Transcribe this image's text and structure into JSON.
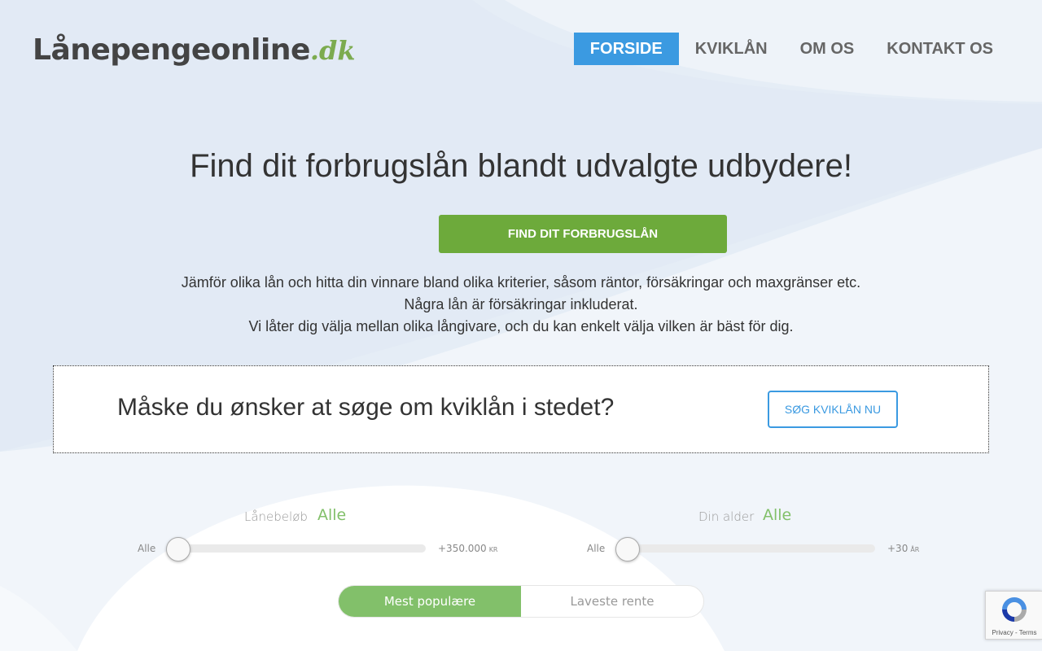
{
  "brand": {
    "name_main": "Lånepengeonline",
    "name_tld": ".dk"
  },
  "nav": [
    {
      "label": "FORSIDE",
      "active": true
    },
    {
      "label": "KVIKLÅN",
      "active": false
    },
    {
      "label": "OM OS",
      "active": false
    },
    {
      "label": "KONTAKT OS",
      "active": false
    }
  ],
  "hero": {
    "title": "Find dit forbrugslån blandt udvalgte udbydere!",
    "cta_label": "FIND DIT FORBRUGSLÅN",
    "desc_lines": [
      "Jämför olika lån och hitta din vinnare bland olika kriterier, såsom räntor, försäkringar och maxgränser etc.",
      "Några lån är försäkringar inkluderat.",
      "Vi låter dig välja mellan olika långivare, och du kan enkelt välja vilken är bäst för dig."
    ]
  },
  "kviklan_box": {
    "text": "Måske du ønsker at søge om kviklån i stedet?",
    "button_label": "SØG KVIKLÅN NU"
  },
  "filters": {
    "amount": {
      "label": "Lånebeløb",
      "value": "Alle",
      "min_label": "Alle",
      "max_label": "+350.000",
      "unit": "KR",
      "position": 0
    },
    "age": {
      "label": "Din alder",
      "value": "Alle",
      "min_label": "Alle",
      "max_label": "+30",
      "unit": "ÅR",
      "position": 0
    }
  },
  "sort": {
    "options": [
      "Mest populære",
      "Laveste rente"
    ],
    "selected": 0
  },
  "recaptcha": {
    "terms": "Privacy - Terms"
  },
  "colors": {
    "accent_blue": "#3b9ae1",
    "cta_green": "#6daa3b",
    "soft_green": "#82c06a"
  }
}
